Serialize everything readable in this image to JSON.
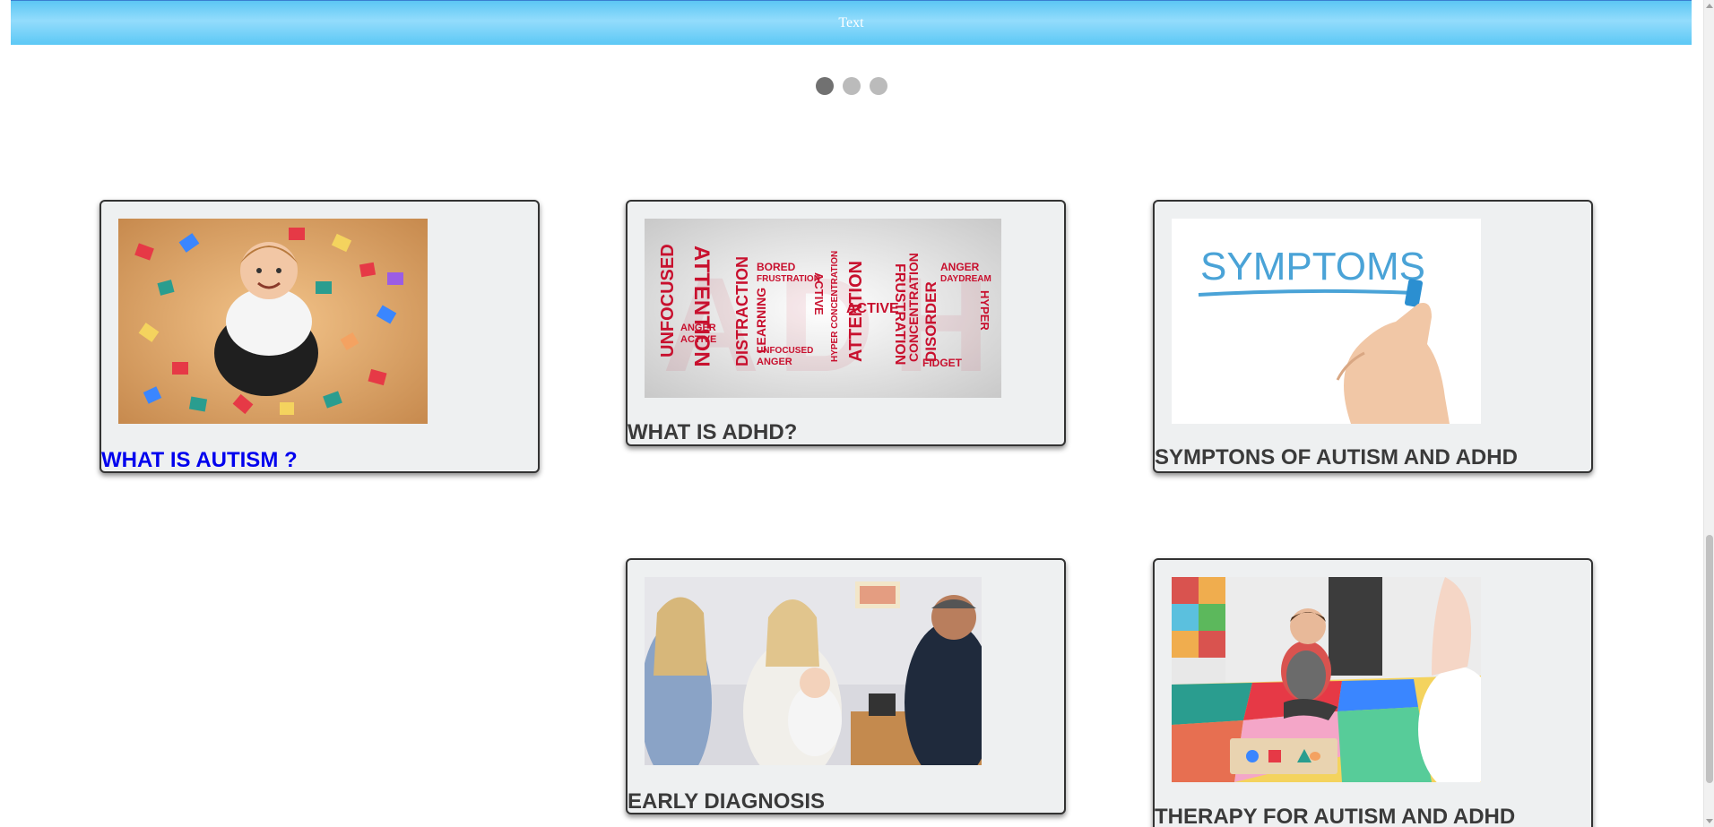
{
  "banner": {
    "text": "Text"
  },
  "slideshow": {
    "total": 3,
    "active": 1
  },
  "cards": [
    {
      "title": "WHAT IS AUTISM ?",
      "image": "boy sitting among colorful puzzle pieces",
      "link_color": "#0000ee"
    },
    {
      "title": "WHAT IS ADHD?",
      "image": "ADHD word cloud",
      "words": [
        "ATTENTION",
        "UNFOCUSED",
        "DISTRACTION",
        "LEARNING",
        "BORED",
        "FRUSTRATION",
        "ACTIVE",
        "HYPER",
        "CONCENTRATION",
        "DISORDER",
        "ANGER",
        "DAYDREAM",
        "FIDGET"
      ]
    },
    {
      "title": "SYMPTONS OF AUTISM AND ADHD",
      "image": "hand writing SYMPTOMS with marker",
      "image_text": "SYMPTOMS"
    },
    {
      "title": "EARLY DIAGNOSIS",
      "image": "doctor consultation with mother and baby"
    },
    {
      "title": "THERAPY FOR AUTISM AND ADHD",
      "image": "child playing on colorful play mat"
    }
  ],
  "colors": {
    "banner_start": "#5cc6f4",
    "banner_mid": "#93dcfc",
    "card_bg": "#eef0f1",
    "title": "#3a3a3a",
    "link": "#0000ee",
    "dot_active": "#717171",
    "dot": "#bbbbbb",
    "adhd_red": "#c8102e"
  }
}
